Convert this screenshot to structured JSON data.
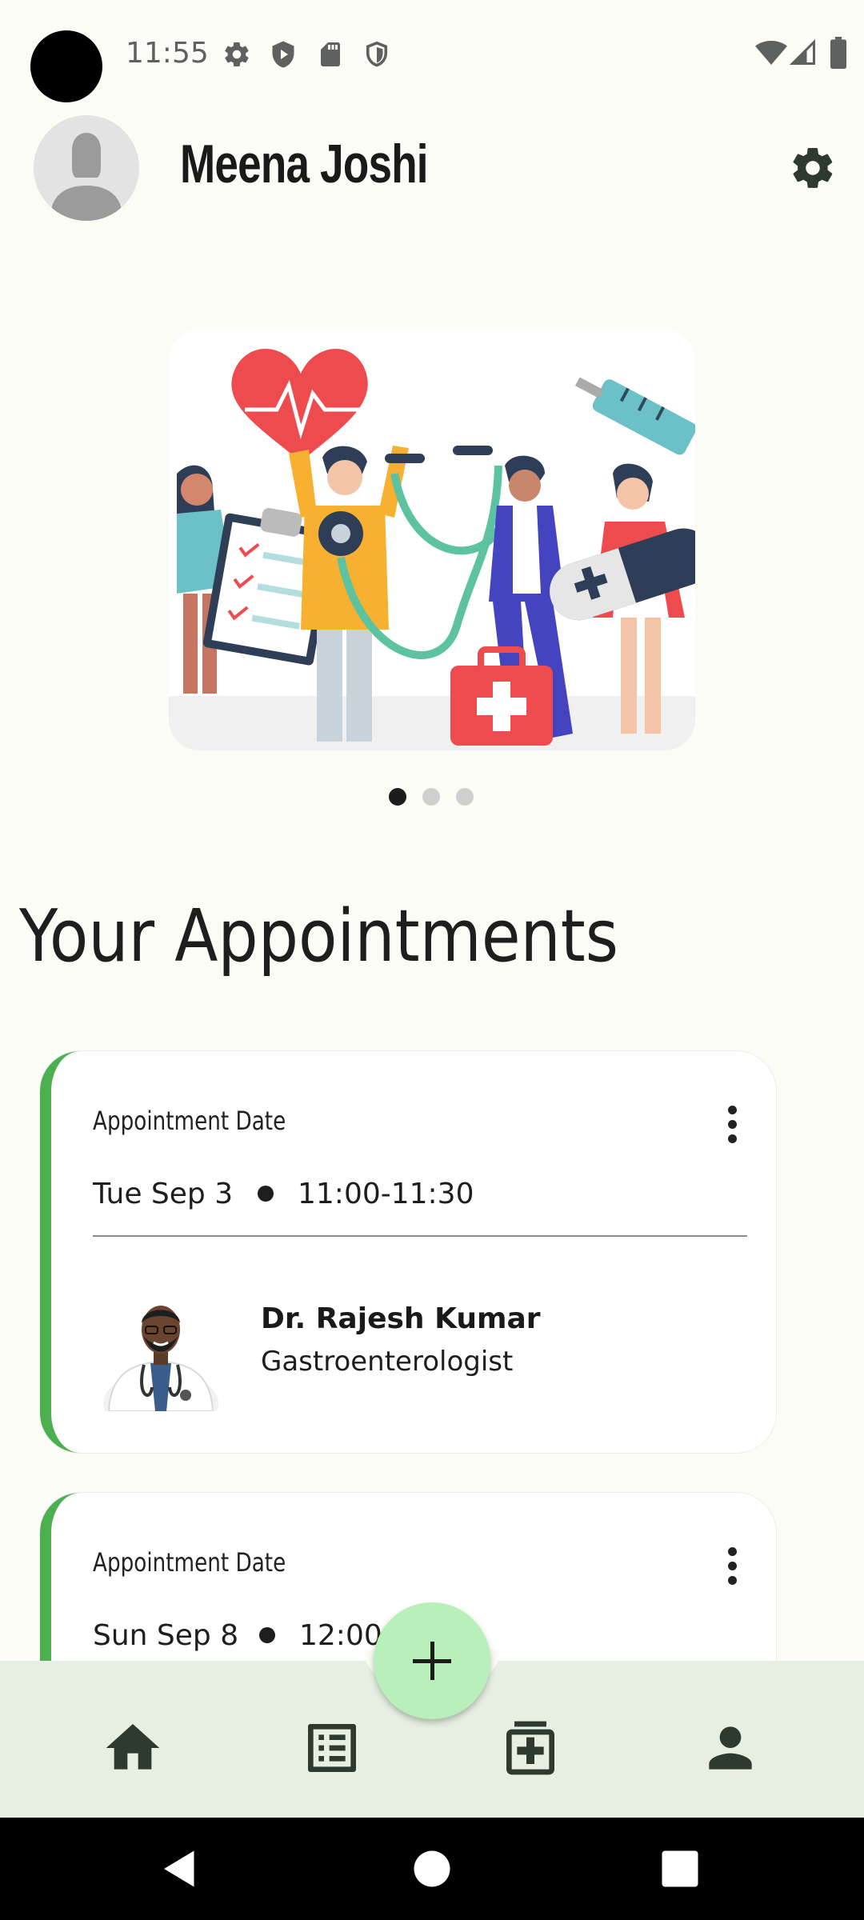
{
  "status_bar": {
    "time": "11:55",
    "icons": [
      "gear-icon",
      "play-protect-icon",
      "sd-card-icon",
      "shield-icon"
    ],
    "right_icons": [
      "wifi-icon",
      "signal-icon",
      "battery-icon"
    ]
  },
  "header": {
    "user_name": "Meena Joshi",
    "avatar_icon": "user-avatar-icon",
    "settings_icon": "settings-icon"
  },
  "carousel": {
    "illustration": "medical-team-illustration",
    "dot_count": 3,
    "active_index": 0
  },
  "section": {
    "title": "Your Appointments"
  },
  "appointments": [
    {
      "label": "Appointment Date",
      "date": "Tue Sep 3",
      "time": "11:00-11:30",
      "doctor_name": "Dr. Rajesh Kumar",
      "specialty": "Gastroenterologist",
      "accent": "#4caf50"
    },
    {
      "label": "Appointment Date",
      "date": "Sun Sep 8",
      "time": "12:00-",
      "accent": "#4caf50"
    }
  ],
  "bottom_nav": {
    "items": [
      "home-icon",
      "list-icon",
      "fab-add-icon",
      "medical-records-icon",
      "profile-icon"
    ],
    "background": "#e6efe2",
    "fab_color": "#b9efb8"
  },
  "system_nav": {
    "buttons": [
      "back-icon",
      "home-circle-icon",
      "recents-icon"
    ]
  }
}
